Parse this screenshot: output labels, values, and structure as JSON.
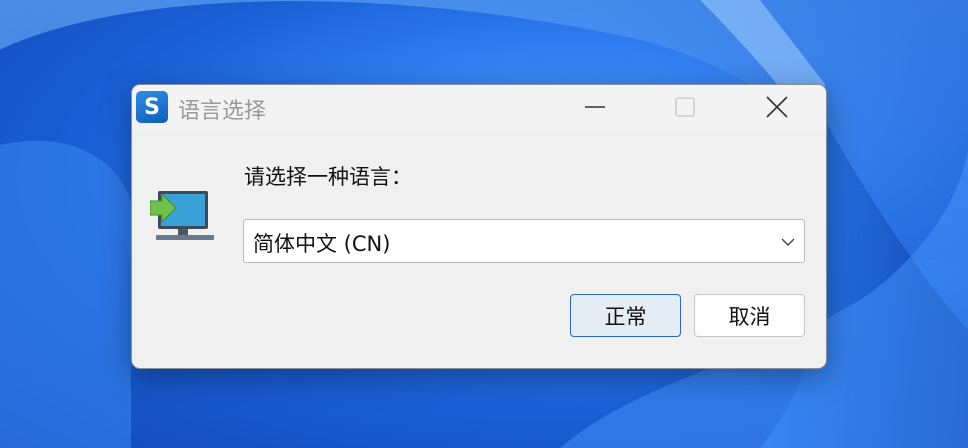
{
  "dialog": {
    "title": "语言选择",
    "app_icon_letter": "S",
    "prompt": "请选择一种语言：",
    "language_select": {
      "selected": "简体中文 (CN)"
    },
    "buttons": {
      "ok_label": "正常",
      "cancel_label": "取消"
    },
    "window_controls": [
      "minimize",
      "maximize",
      "close"
    ]
  },
  "colors": {
    "ok_border": "#2a68c0",
    "wallpaper": "#1a5fd6"
  }
}
